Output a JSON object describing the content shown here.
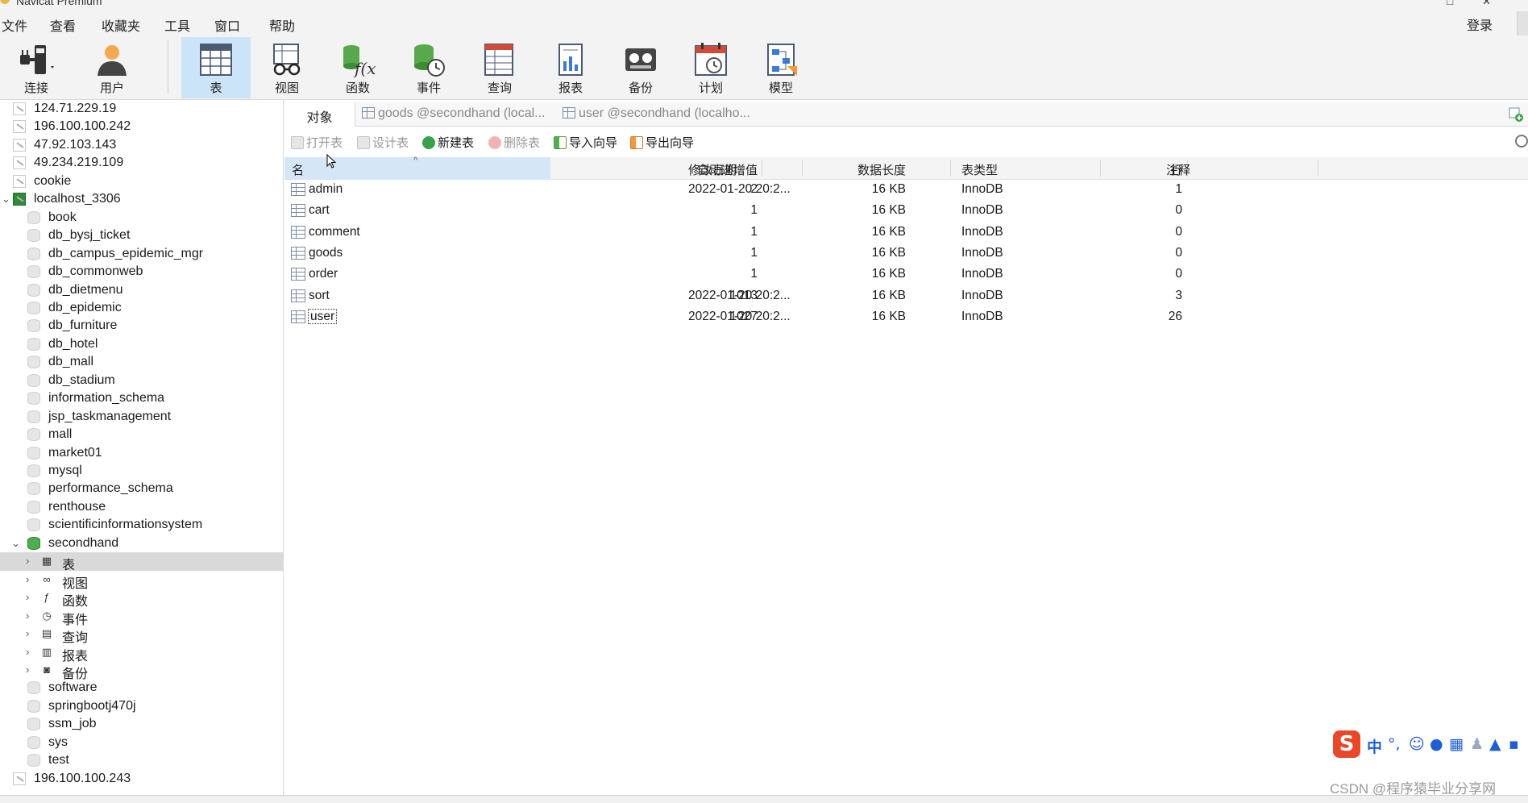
{
  "window": {
    "title": "Navicat Premium"
  },
  "menu": [
    "文件",
    "查看",
    "收藏夹",
    "工具",
    "窗口",
    "帮助"
  ],
  "login_label": "登录",
  "toolbar": [
    {
      "label": "连接",
      "icon": "plug-icon"
    },
    {
      "label": "用户",
      "icon": "user-icon"
    },
    {
      "label": "表",
      "icon": "table-icon",
      "active": true
    },
    {
      "label": "视图",
      "icon": "view-glasses-icon"
    },
    {
      "label": "函数",
      "icon": "function-icon"
    },
    {
      "label": "事件",
      "icon": "event-clock-icon"
    },
    {
      "label": "查询",
      "icon": "query-icon"
    },
    {
      "label": "报表",
      "icon": "report-icon"
    },
    {
      "label": "备份",
      "icon": "backup-icon"
    },
    {
      "label": "计划",
      "icon": "schedule-calendar-icon"
    },
    {
      "label": "模型",
      "icon": "model-icon"
    }
  ],
  "sidebar": {
    "connections_top": [
      "124.71.229.19",
      "196.100.100.242",
      "47.92.103.143",
      "49.234.219.109",
      "cookie"
    ],
    "open_connection": "localhost_3306",
    "databases_before": [
      "book",
      "db_bysj_ticket",
      "db_campus_epidemic_mgr",
      "db_commonweb",
      "db_dietmenu",
      "db_epidemic",
      "db_furniture",
      "db_hotel",
      "db_mall",
      "db_stadium",
      "information_schema",
      "jsp_taskmanagement",
      "mall",
      "market01",
      "mysql",
      "performance_schema",
      "renthouse",
      "scientificinformationsystem"
    ],
    "open_database": "secondhand",
    "object_groups": [
      "表",
      "视图",
      "函数",
      "事件",
      "查询",
      "报表",
      "备份"
    ],
    "databases_after": [
      "software",
      "springbootj470j",
      "ssm_job",
      "sys",
      "test"
    ],
    "connections_bottom": [
      "196.100.100.243"
    ]
  },
  "tabs": {
    "objects": "对象",
    "open": [
      "goods @secondhand (local...",
      "user @secondhand (localho..."
    ]
  },
  "actions": [
    {
      "label": "打开表",
      "enabled": false
    },
    {
      "label": "设计表",
      "enabled": false
    },
    {
      "label": "新建表",
      "enabled": true
    },
    {
      "label": "删除表",
      "enabled": false
    },
    {
      "label": "导入向导",
      "enabled": true
    },
    {
      "label": "导出向导",
      "enabled": true
    }
  ],
  "table": {
    "columns": [
      "名",
      "自动递增值",
      "修改日期",
      "数据长度",
      "表类型",
      "行",
      "注释"
    ],
    "rows": [
      [
        "admin",
        "2",
        "2022-01-20 20:2...",
        "16 KB",
        "InnoDB",
        "1",
        ""
      ],
      [
        "cart",
        "1",
        "",
        "16 KB",
        "InnoDB",
        "0",
        ""
      ],
      [
        "comment",
        "1",
        "",
        "16 KB",
        "InnoDB",
        "0",
        ""
      ],
      [
        "goods",
        "1",
        "",
        "16 KB",
        "InnoDB",
        "0",
        ""
      ],
      [
        "order",
        "1",
        "",
        "16 KB",
        "InnoDB",
        "0",
        ""
      ],
      [
        "sort",
        "1013",
        "2022-01-20 20:2...",
        "16 KB",
        "InnoDB",
        "3",
        ""
      ],
      [
        "user",
        "1027",
        "2022-01-20 20:2...",
        "16 KB",
        "InnoDB",
        "26",
        ""
      ]
    ]
  },
  "ime": {
    "logo": "S",
    "lang": "中"
  },
  "watermark": "CSDN @程序猿毕业分享网",
  "colors": {
    "selected_tab": "#cce4f7",
    "selected_tree": "#d9d9d9",
    "header_first": "#d5e7f7",
    "conn_green": "#2f8a3a",
    "db_green": "#4caf50"
  }
}
